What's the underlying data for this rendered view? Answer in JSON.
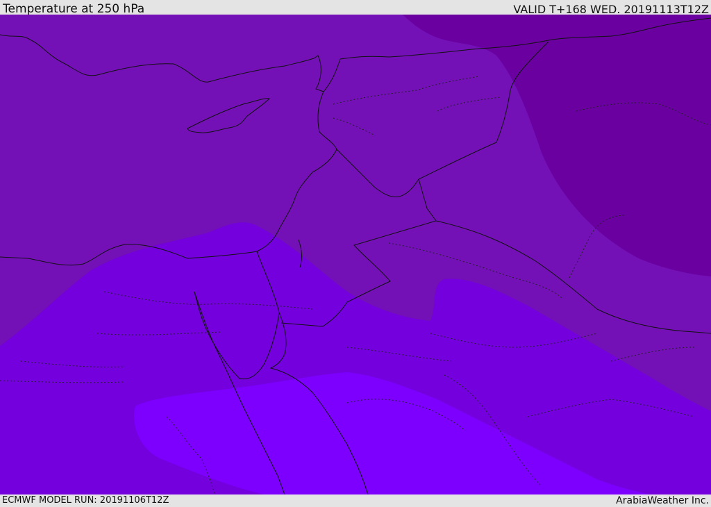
{
  "header": {
    "title": "Temperature at 250 hPa",
    "valid": "VALID T+168 WED. 20191113T12Z"
  },
  "footer": {
    "model_run": "ECMWF MODEL RUN: 20191106T12Z",
    "credit": "ArabiaWeather Inc."
  },
  "colors": {
    "band_warmest": "#7d00ff",
    "band_warm": "#7300dd",
    "band_mid": "#7310b6",
    "band_cold": "#69009f",
    "coast": "#111111"
  }
}
